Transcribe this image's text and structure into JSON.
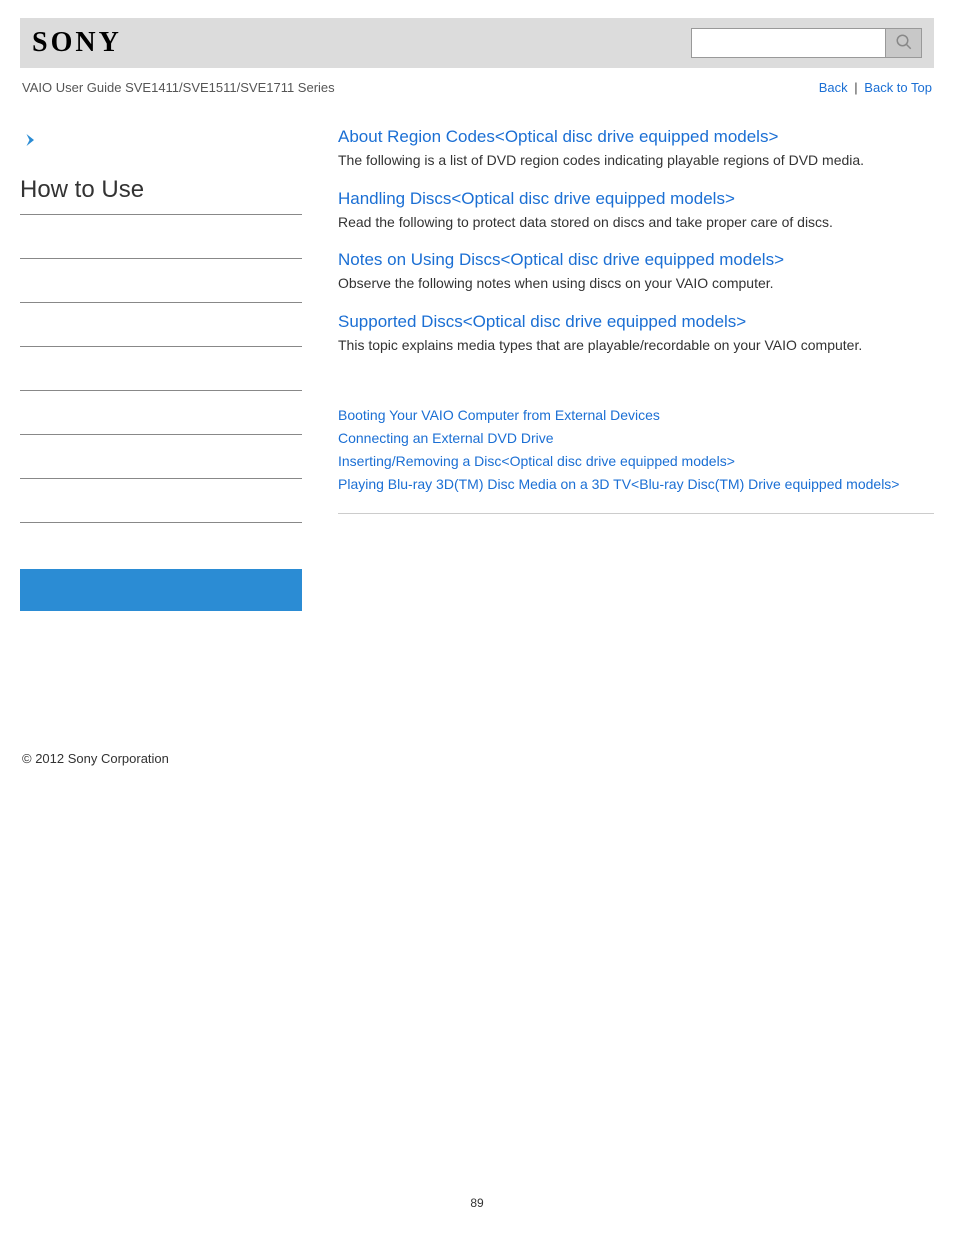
{
  "header": {
    "logo_text": "SONY",
    "search_placeholder": ""
  },
  "subheader": {
    "guide_title": "VAIO User Guide SVE1411/SVE1511/SVE1711 Series",
    "back": "Back",
    "back_to_top": "Back to Top"
  },
  "sidebar": {
    "title": "How to Use"
  },
  "topics": [
    {
      "title": "About Region Codes<Optical disc drive equipped models>",
      "desc": "The following is a list of DVD region codes indicating playable regions of DVD media."
    },
    {
      "title": "Handling Discs<Optical disc drive equipped models>",
      "desc": "Read the following to protect data stored on discs and take proper care of discs."
    },
    {
      "title": "Notes on Using Discs<Optical disc drive equipped models>",
      "desc": "Observe the following notes when using discs on your VAIO computer."
    },
    {
      "title": "Supported Discs<Optical disc drive equipped models>",
      "desc": "This topic explains media types that are playable/recordable on your VAIO computer."
    }
  ],
  "related": [
    "Booting Your VAIO Computer from External Devices",
    "Connecting an External DVD Drive",
    "Inserting/Removing a Disc<Optical disc drive equipped models>",
    "Playing Blu-ray 3D(TM) Disc Media on a 3D TV<Blu-ray Disc(TM) Drive equipped models>"
  ],
  "footer": {
    "copyright": "© 2012 Sony Corporation"
  },
  "page_number": "89"
}
